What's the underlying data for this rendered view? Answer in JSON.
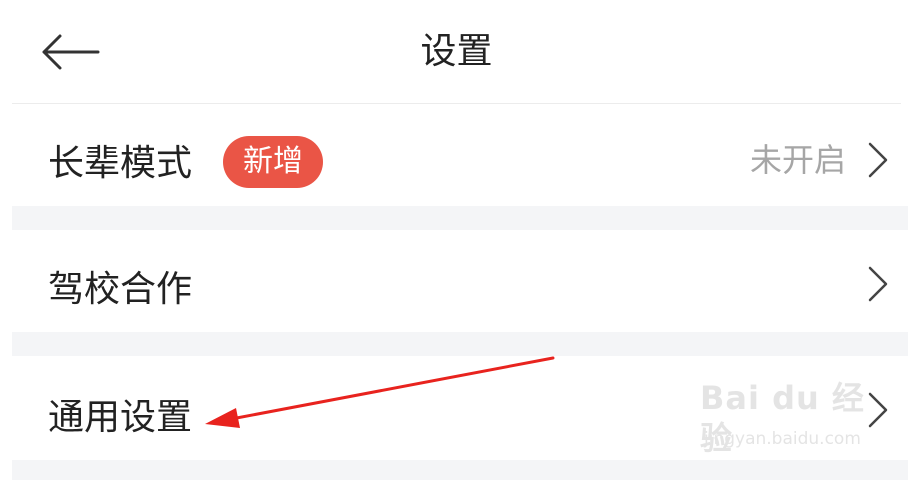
{
  "header": {
    "title": "设置",
    "back_icon": "arrow-left-icon"
  },
  "settings": {
    "elder_mode": {
      "label": "长辈模式",
      "badge": "新增",
      "value": "未开启"
    },
    "driving_school": {
      "label": "驾校合作"
    },
    "general": {
      "label": "通用设置"
    }
  },
  "watermark": {
    "main": "Bai du 经验",
    "sub": "jingyan.baidu.com"
  },
  "colors": {
    "badge": "#ea5546",
    "secondary_text": "#a6a6a6",
    "separator": "#f4f5f7",
    "annotation_arrow": "#e8231e"
  }
}
